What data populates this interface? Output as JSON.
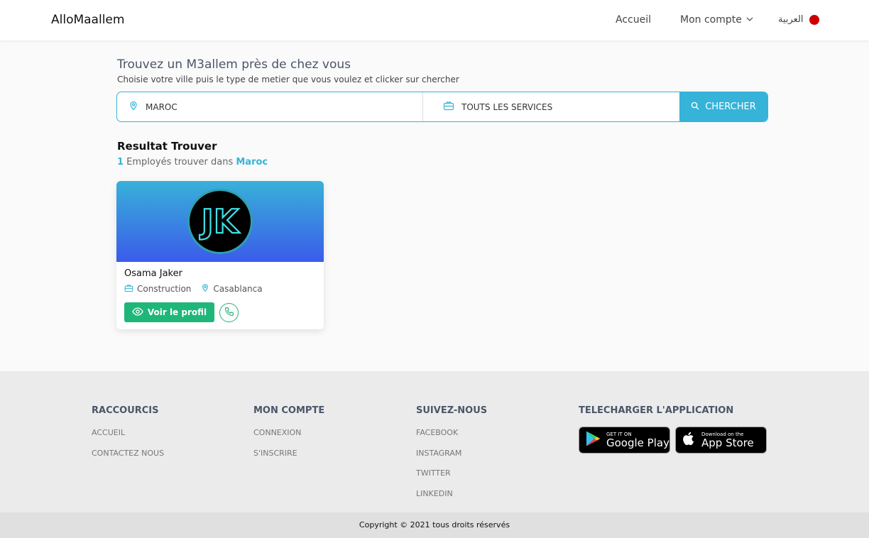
{
  "header": {
    "logo": "AlloMaallem",
    "nav": {
      "home": "Accueil",
      "account": "Mon compte",
      "language": "العربية"
    }
  },
  "search": {
    "title": "Trouvez un M3allem près de chez vous",
    "subtitle": "Choisie votre ville puis le type de metier que vous voulez et clicker sur chercher",
    "city_value": "MAROC",
    "service_value": "TOUTS LES SERVICES",
    "button_label": "CHERCHER"
  },
  "results": {
    "title": "Resultat Trouver",
    "count": "1",
    "count_text": " Employés trouver dans ",
    "location": "Maroc"
  },
  "cards": [
    {
      "avatar_initials": "JK",
      "name": "Osama Jaker",
      "trade": "Construction",
      "city": "Casablanca",
      "profile_button": "Voir le profil"
    }
  ],
  "footer": {
    "col1": {
      "title": "RACCOURCIS",
      "links": [
        "ACCUEIL",
        "CONTACTEZ NOUS"
      ]
    },
    "col2": {
      "title": "MON COMPTE",
      "links": [
        "CONNEXION",
        "S'INSCRIRE"
      ]
    },
    "col3": {
      "title": "SUIVEZ-NOUS",
      "links": [
        "FACEBOOK",
        "INSTAGRAM",
        "TWITTER",
        "LINKEDIN"
      ]
    },
    "col4": {
      "title": "TELECHARGER L'APPLICATION"
    },
    "google_play": {
      "small": "GET IT ON",
      "big": "Google Play"
    },
    "app_store": {
      "small": "Download on the",
      "big": "App Store"
    },
    "copyright": "Copyright © 2021 tous droits réservés"
  },
  "colors": {
    "accent": "#36b3d9",
    "green": "#1fb67a",
    "flag": "#cc0000"
  }
}
